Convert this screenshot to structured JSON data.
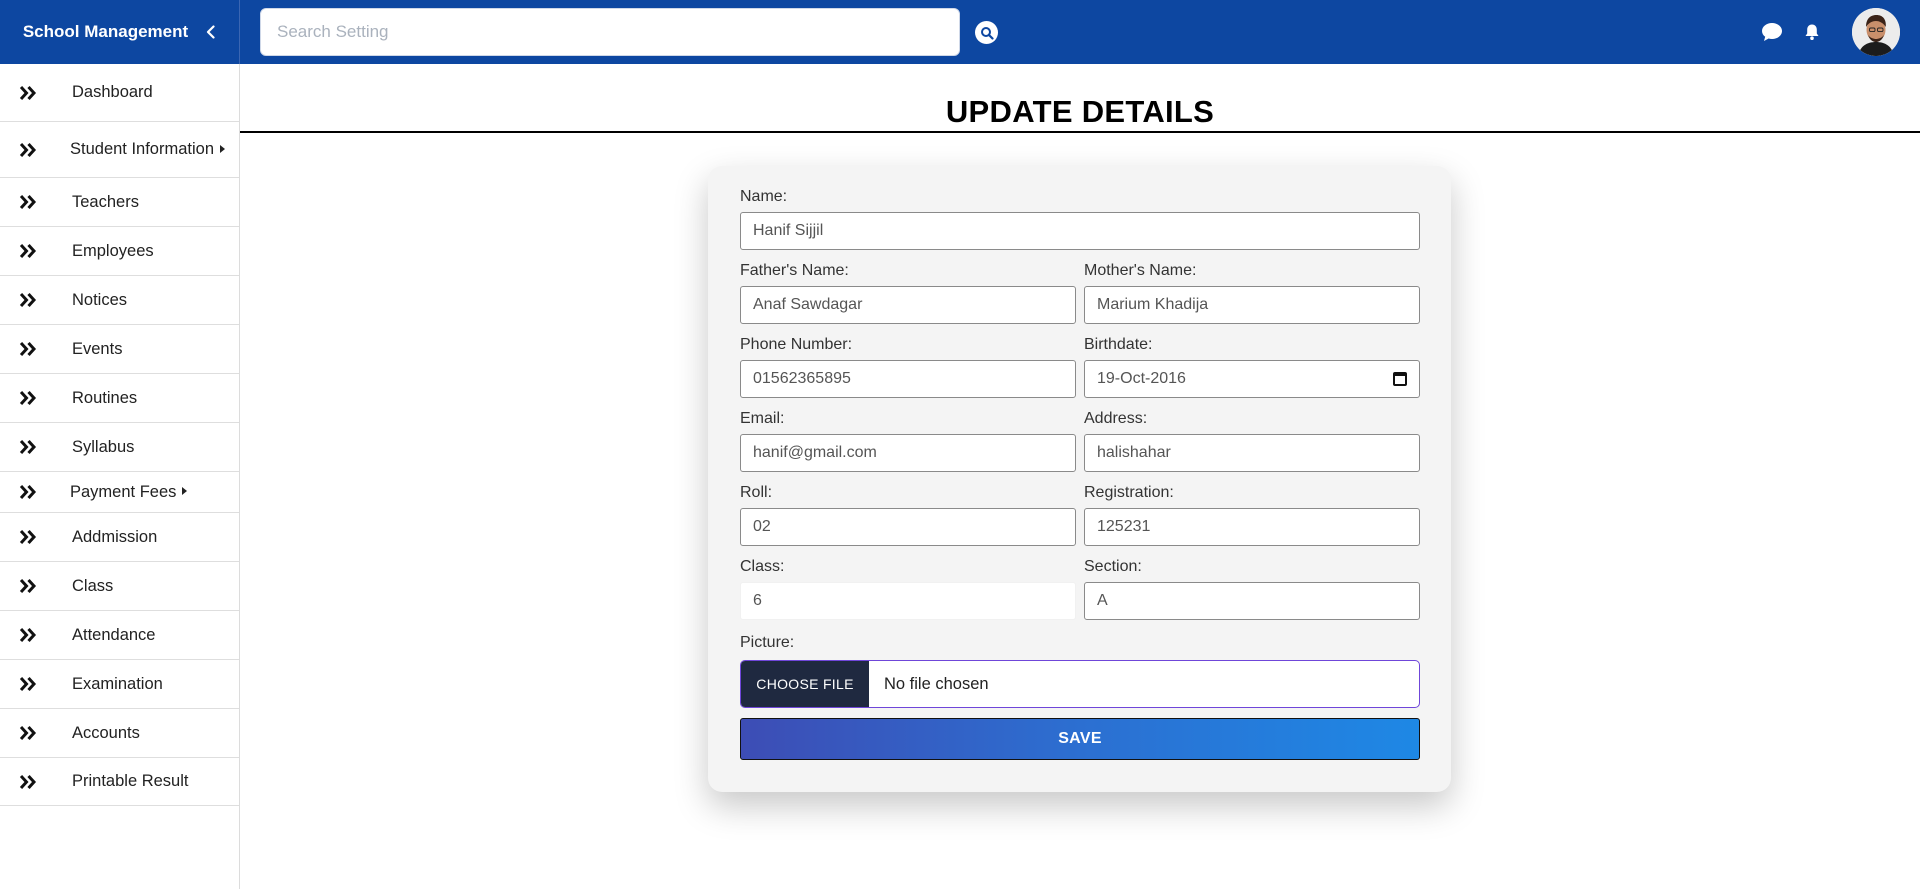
{
  "brand": {
    "title": "School Management"
  },
  "search": {
    "placeholder": "Search Setting"
  },
  "sidebar": {
    "items": [
      {
        "label": "Dashboard",
        "submenu": false
      },
      {
        "label": "Student Information",
        "submenu": true
      },
      {
        "label": "Teachers",
        "submenu": false
      },
      {
        "label": "Employees",
        "submenu": false
      },
      {
        "label": "Notices",
        "submenu": false
      },
      {
        "label": "Events",
        "submenu": false
      },
      {
        "label": "Routines",
        "submenu": false
      },
      {
        "label": "Syllabus",
        "submenu": false
      },
      {
        "label": "Payment Fees",
        "submenu": true
      },
      {
        "label": "Addmission",
        "submenu": false
      },
      {
        "label": "Class",
        "submenu": false
      },
      {
        "label": "Attendance",
        "submenu": false
      },
      {
        "label": "Examination",
        "submenu": false
      },
      {
        "label": "Accounts",
        "submenu": false
      },
      {
        "label": "Printable Result",
        "submenu": false
      }
    ]
  },
  "page": {
    "title": "UPDATE DETAILS"
  },
  "form": {
    "name": {
      "label": "Name:",
      "value": "Hanif Sijjil"
    },
    "father": {
      "label": "Father's Name:",
      "value": "Anaf Sawdagar"
    },
    "mother": {
      "label": "Mother's Name:",
      "value": "Marium Khadija"
    },
    "phone": {
      "label": "Phone Number:",
      "value": "01562365895"
    },
    "birthdate": {
      "label": "Birthdate:",
      "value": "19-Oct-2016"
    },
    "email": {
      "label": "Email:",
      "value": "hanif@gmail.com"
    },
    "address": {
      "label": "Address:",
      "value": "halishahar"
    },
    "roll": {
      "label": "Roll:",
      "value": "02"
    },
    "registration": {
      "label": "Registration:",
      "value": "125231"
    },
    "class": {
      "label": "Class:",
      "value": "6"
    },
    "section": {
      "label": "Section:",
      "value": "A"
    },
    "picture": {
      "label": "Picture:",
      "button_label": "CHOOSE FILE",
      "status": "No file chosen"
    },
    "save_label": "SAVE"
  },
  "colors": {
    "topbar": "#0d47a1",
    "save_start": "#3d4db5",
    "save_end": "#1e88e5",
    "file_button": "#1f2940"
  },
  "icons": {
    "collapse": "chevron-left-icon",
    "search": "search-icon",
    "chat": "chat-icon",
    "notifications": "bell-icon",
    "sidebar_item": "double-chevron-right-icon",
    "date": "calendar-icon"
  }
}
